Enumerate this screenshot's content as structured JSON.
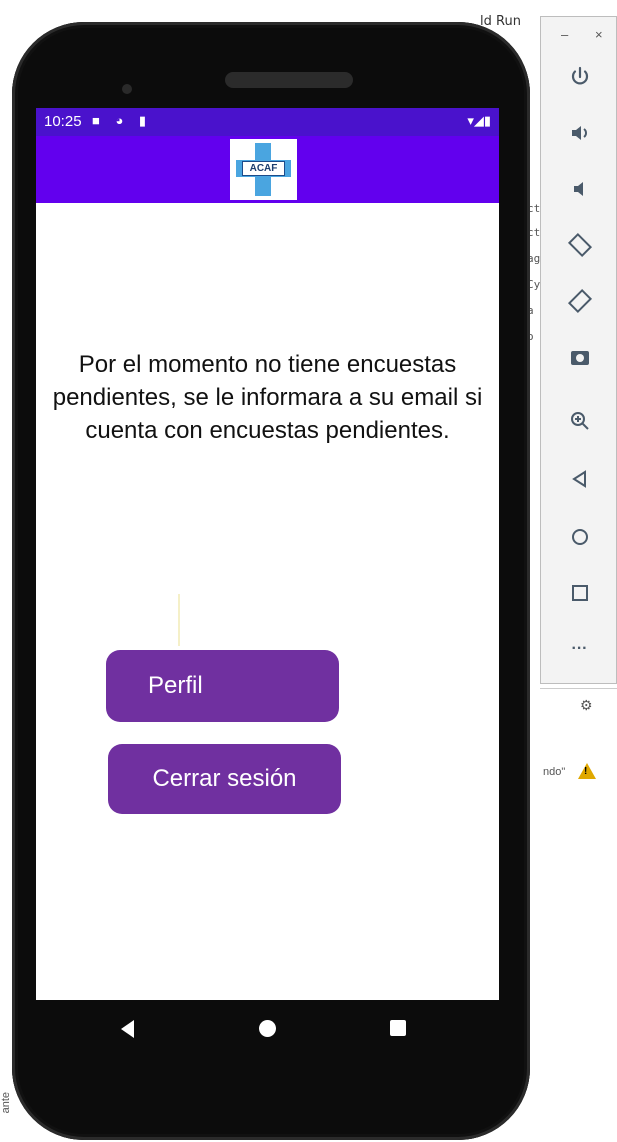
{
  "ide": {
    "top_label": "ld",
    "run_menu": "Run",
    "side_snippets": [
      "ct",
      "ct",
      "ag",
      "Cy",
      "a",
      "o"
    ],
    "warning_label": "ndo\"",
    "vertical_label": "ante"
  },
  "emulator_toolbar": {
    "minimize": "–",
    "close": "×",
    "buttons": [
      {
        "name": "power-icon",
        "glyph": "⏻"
      },
      {
        "name": "volume-up-icon",
        "glyph": "🔊"
      },
      {
        "name": "volume-down-icon",
        "glyph": "🔉"
      },
      {
        "name": "rotate-left-icon",
        "glyph": "⟲"
      },
      {
        "name": "rotate-right-icon",
        "glyph": "⟳"
      },
      {
        "name": "camera-icon",
        "glyph": "📷"
      },
      {
        "name": "zoom-icon",
        "glyph": "🔍"
      },
      {
        "name": "back-icon",
        "glyph": "◁"
      },
      {
        "name": "home-icon",
        "glyph": "○"
      },
      {
        "name": "overview-icon",
        "glyph": "□"
      },
      {
        "name": "more-icon",
        "glyph": "···"
      }
    ]
  },
  "status_bar": {
    "time": "10:25",
    "left_icons": "■ ◕ ▮",
    "right_icons": "▾◢▮"
  },
  "app_bar": {
    "logo_text": "ACAF"
  },
  "main": {
    "message": "Por el momento no tiene encuestas pendientes, se le informara a su email si cuenta con encuestas pendientes."
  },
  "buttons": {
    "profile": "Perfil",
    "logout": "Cerrar sesión"
  },
  "colors": {
    "status_bar": "#4a12cc",
    "app_bar": "#6200ee",
    "button": "#7030a0"
  }
}
